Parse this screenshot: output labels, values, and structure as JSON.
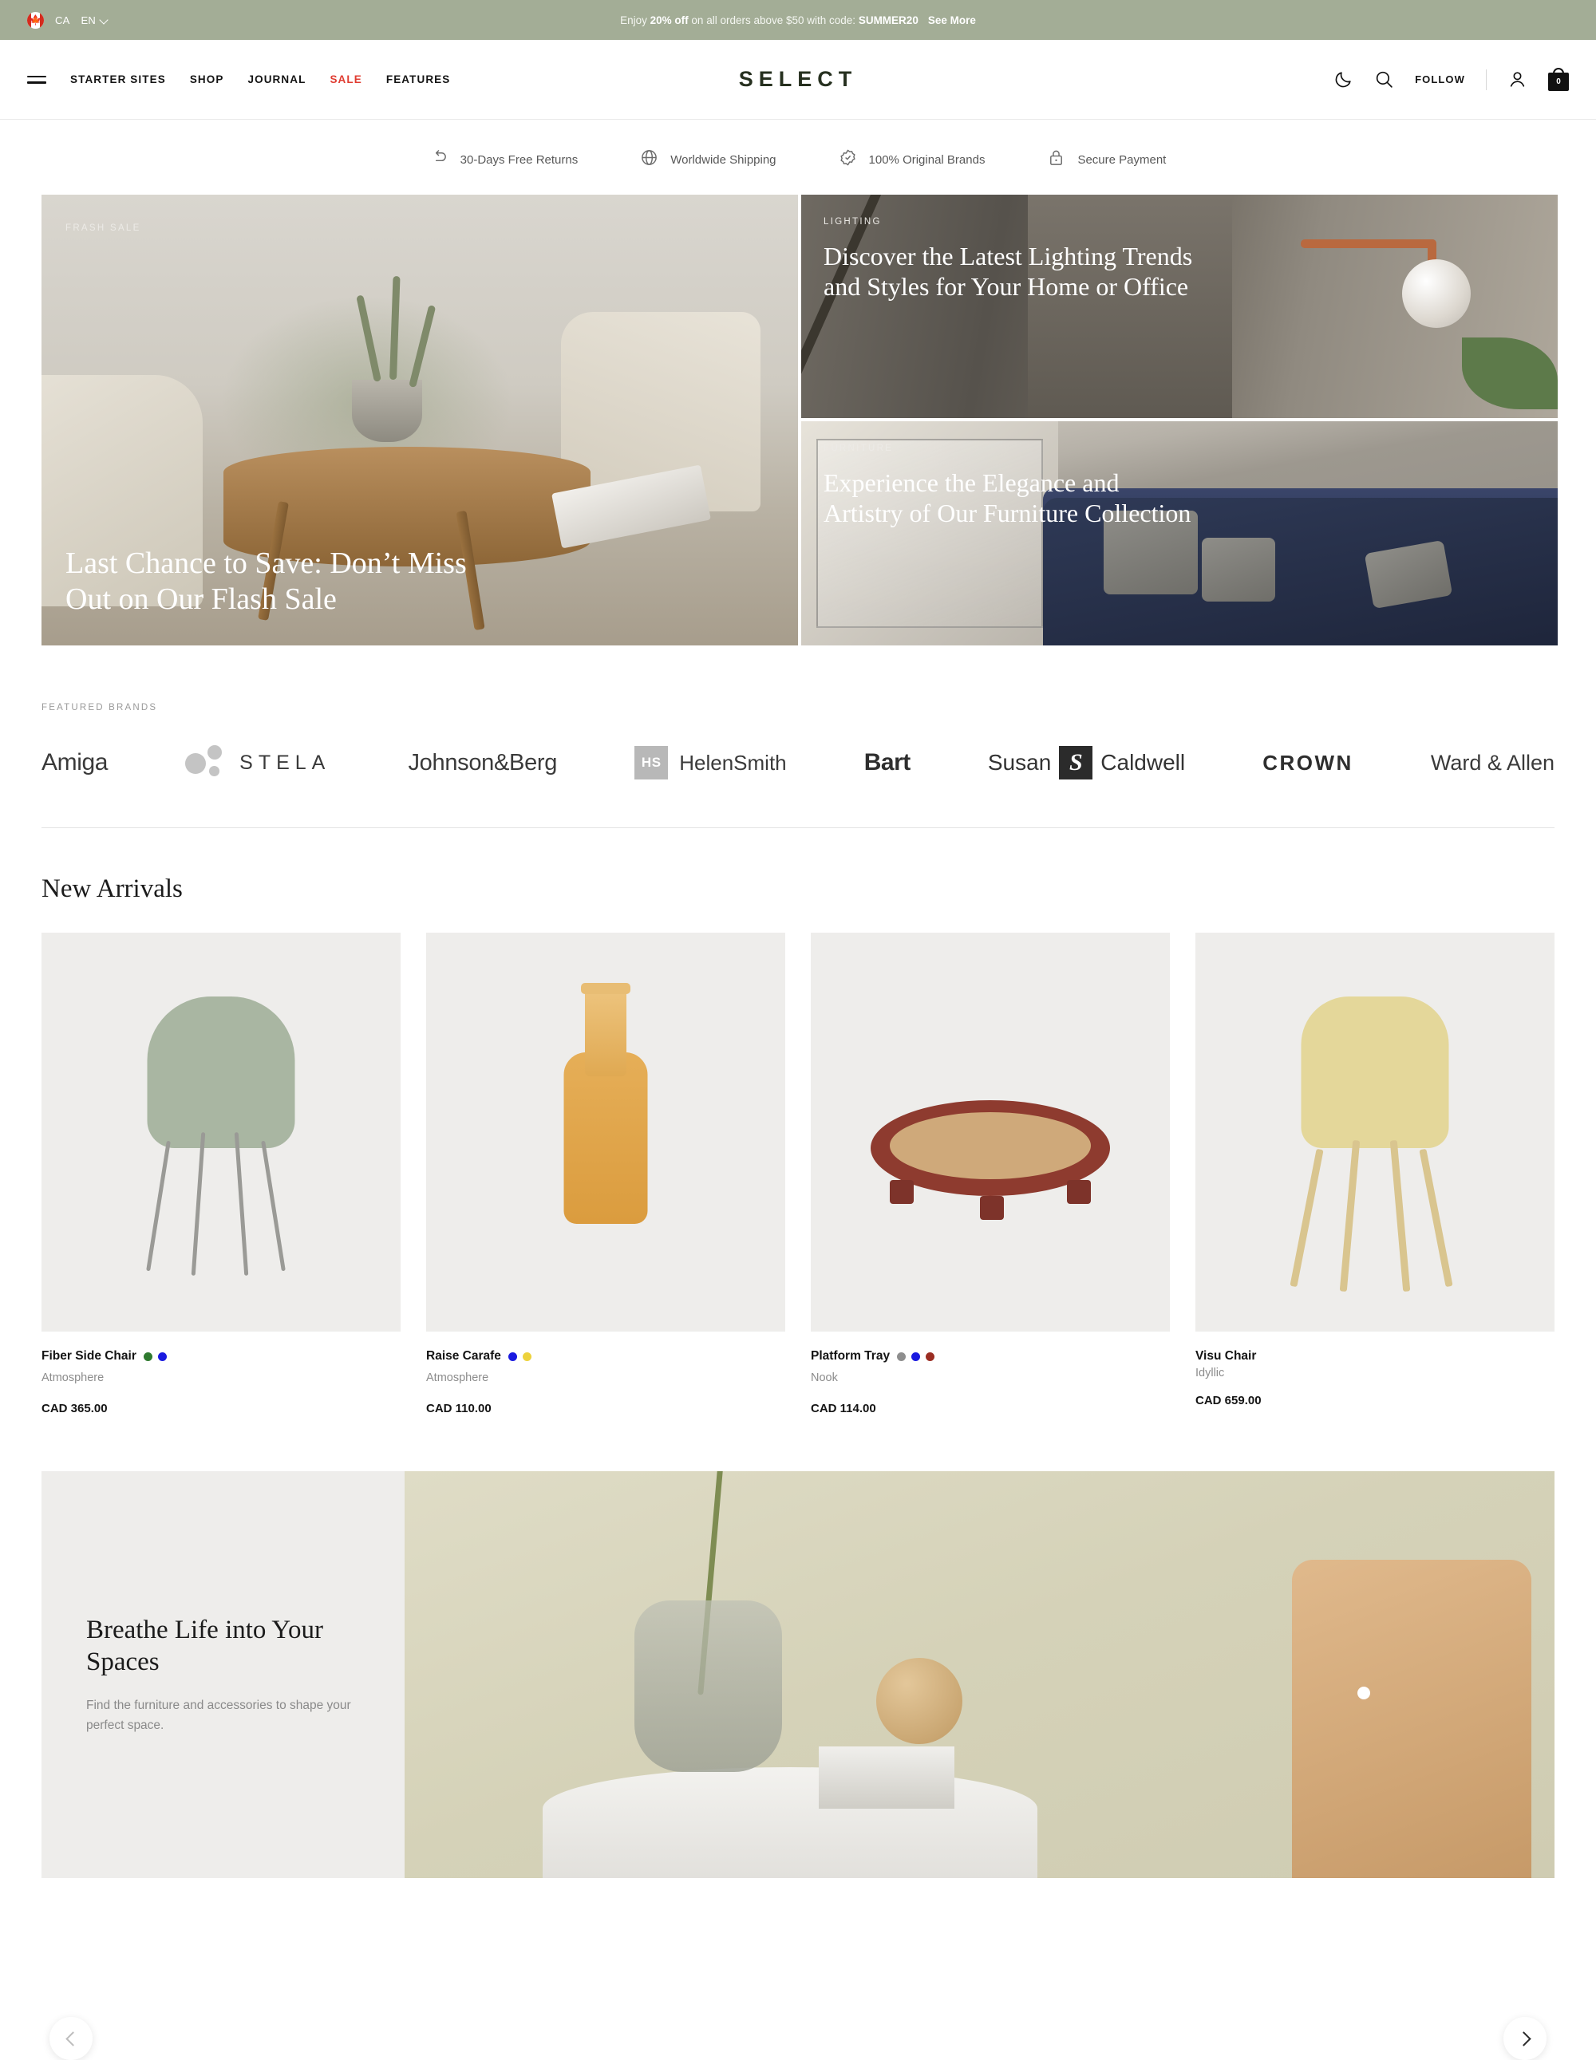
{
  "announcement": {
    "country_code": "CA",
    "flag_icon": "canada-flag-icon",
    "language": "EN",
    "chevron_icon": "chevron-down-icon",
    "promo_prefix": "Enjoy ",
    "promo_bold": "20% off",
    "promo_middle": " on all orders above $50 with code: ",
    "promo_code": "SUMMER20",
    "see_more": "See More"
  },
  "header": {
    "menu_icon": "hamburger-menu-icon",
    "logo": "SELECT",
    "nav": [
      {
        "label": "STARTER SITES",
        "highlight": false
      },
      {
        "label": "SHOP",
        "highlight": false
      },
      {
        "label": "JOURNAL",
        "highlight": false
      },
      {
        "label": "SALE",
        "highlight": true
      },
      {
        "label": "FEATURES",
        "highlight": false
      }
    ],
    "dark_mode_icon": "moon-icon",
    "search_icon": "search-icon",
    "follow_label": "FOLLOW",
    "account_icon": "user-account-icon",
    "cart_icon": "shopping-bag-icon",
    "cart_count": "0",
    "sale_color": "#e03c31"
  },
  "trustbar": [
    {
      "icon": "return-arrow-icon",
      "label": "30-Days Free Returns"
    },
    {
      "icon": "globe-icon",
      "label": "Worldwide Shipping"
    },
    {
      "icon": "badge-check-icon",
      "label": "100% Original Brands"
    },
    {
      "icon": "lock-icon",
      "label": "Secure Payment"
    }
  ],
  "hero": {
    "flash": {
      "eyebrow": "FRASH SALE",
      "title": "Last Chance to Save: Don’t Miss Out on Our Flash Sale"
    },
    "lighting": {
      "eyebrow": "LIGHTING",
      "title": "Discover the Latest Lighting Trends and Styles for Your Home or Office"
    },
    "furniture": {
      "eyebrow": "FURNITURE",
      "title": "Experience the Elegance and Artistry of Our Furniture Collection"
    }
  },
  "brands": {
    "label": "FEATURED BRANDS",
    "items": [
      {
        "name": "Amiga"
      },
      {
        "name": "STELA"
      },
      {
        "name": "Johnson&Berg"
      },
      {
        "name": "HelenSmith",
        "mark": "HS"
      },
      {
        "name": "Bart"
      },
      {
        "name": "Susan Caldwell",
        "first": "Susan",
        "mark": "S",
        "last": "Caldwell"
      },
      {
        "name": "CROWN"
      },
      {
        "name": "Ward & Allen"
      }
    ]
  },
  "new_arrivals": {
    "title": "New Arrivals",
    "prev_icon": "chevron-left-icon",
    "next_icon": "chevron-right-icon",
    "products": [
      {
        "title": "Fiber Side Chair",
        "brand": "Atmosphere",
        "price": "CAD 365.00",
        "swatches": [
          "#2f7a2f",
          "#1a1ae0"
        ]
      },
      {
        "title": "Raise Carafe",
        "brand": "Atmosphere",
        "price": "CAD 110.00",
        "swatches": [
          "#1a1ae0",
          "#edd23c"
        ]
      },
      {
        "title": "Platform Tray",
        "brand": "Nook",
        "price": "CAD 114.00",
        "swatches": [
          "#8e8e8e",
          "#1a1ae0",
          "#9b2d22"
        ]
      },
      {
        "title": "Visu Chair",
        "brand": "Idyllic",
        "price": "CAD 659.00",
        "swatches": []
      }
    ]
  },
  "promo": {
    "title": "Breathe Life into Your Spaces",
    "subtitle": "Find the furniture and accessories to shape your perfect space."
  }
}
